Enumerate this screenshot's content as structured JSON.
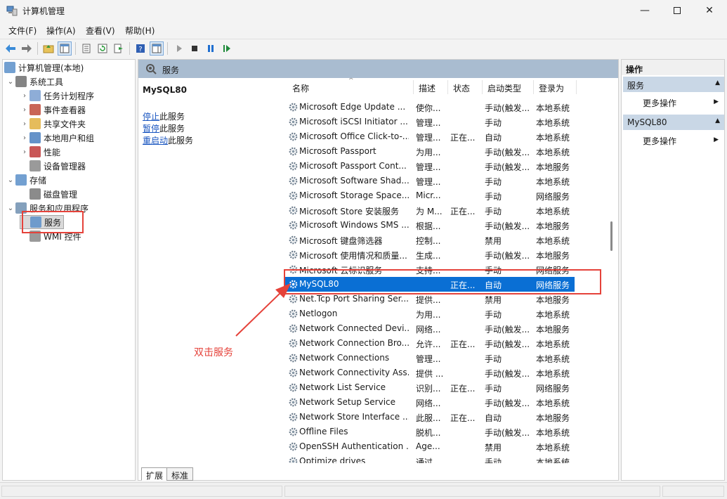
{
  "window": {
    "title": "计算机管理",
    "minimize_icon": "minimize-icon",
    "maximize_icon": "maximize-icon",
    "close_icon": "close-icon"
  },
  "menu": [
    "文件(F)",
    "操作(A)",
    "查看(V)",
    "帮助(H)"
  ],
  "toolbar": {
    "icons": [
      "back-arrow-icon",
      "forward-arrow-icon",
      "up-folder-icon",
      "show-hide-tree-icon",
      "properties-icon",
      "refresh-icon",
      "export-list-icon",
      "help-icon",
      "show-hide-action-pane-icon",
      "start-service-icon",
      "stop-service-icon",
      "pause-service-icon",
      "resume-service-icon"
    ]
  },
  "tree": [
    {
      "label": "计算机管理(本地)",
      "level": 0,
      "chevron": "",
      "icon": "computer-management-icon"
    },
    {
      "label": "系统工具",
      "level": 1,
      "chevron": "⌄",
      "icon": "tools-icon"
    },
    {
      "label": "任务计划程序",
      "level": 2,
      "chevron": "›",
      "icon": "task-scheduler-icon"
    },
    {
      "label": "事件查看器",
      "level": 2,
      "chevron": "›",
      "icon": "event-viewer-icon"
    },
    {
      "label": "共享文件夹",
      "level": 2,
      "chevron": "›",
      "icon": "shared-folder-icon"
    },
    {
      "label": "本地用户和组",
      "level": 2,
      "chevron": "›",
      "icon": "users-groups-icon"
    },
    {
      "label": "性能",
      "level": 2,
      "chevron": "›",
      "icon": "performance-icon"
    },
    {
      "label": "设备管理器",
      "level": 2,
      "chevron": "",
      "icon": "device-manager-icon"
    },
    {
      "label": "存储",
      "level": 1,
      "chevron": "⌄",
      "icon": "storage-icon"
    },
    {
      "label": "磁盘管理",
      "level": 2,
      "chevron": "",
      "icon": "disk-management-icon"
    },
    {
      "label": "服务和应用程序",
      "level": 1,
      "chevron": "⌄",
      "icon": "services-apps-icon"
    },
    {
      "label": "服务",
      "level": 2,
      "chevron": "",
      "icon": "services-icon",
      "selected": true
    },
    {
      "label": "WMI 控件",
      "level": 2,
      "chevron": "",
      "icon": "wmi-control-icon"
    }
  ],
  "center": {
    "header": "服务",
    "selected_service": "MySQL80",
    "actions": [
      {
        "link": "停止",
        "rest": "此服务"
      },
      {
        "link": "暂停",
        "rest": "此服务"
      },
      {
        "link": "重启动",
        "rest": "此服务"
      }
    ],
    "columns": [
      "名称",
      "描述",
      "状态",
      "启动类型",
      "登录为"
    ],
    "rows": [
      {
        "name": "Microsoft Edge Update ...",
        "desc": "使你...",
        "status": "",
        "startup": "手动(触发...",
        "logon": "本地系统"
      },
      {
        "name": "Microsoft iSCSI Initiator ...",
        "desc": "管理...",
        "status": "",
        "startup": "手动",
        "logon": "本地系统"
      },
      {
        "name": "Microsoft Office Click-to-...",
        "desc": "管理...",
        "status": "正在...",
        "startup": "自动",
        "logon": "本地系统"
      },
      {
        "name": "Microsoft Passport",
        "desc": "为用...",
        "status": "",
        "startup": "手动(触发...",
        "logon": "本地系统"
      },
      {
        "name": "Microsoft Passport Cont...",
        "desc": "管理...",
        "status": "",
        "startup": "手动(触发...",
        "logon": "本地服务"
      },
      {
        "name": "Microsoft Software Shad...",
        "desc": "管理...",
        "status": "",
        "startup": "手动",
        "logon": "本地系统"
      },
      {
        "name": "Microsoft Storage Space...",
        "desc": "Micr...",
        "status": "",
        "startup": "手动",
        "logon": "网络服务"
      },
      {
        "name": "Microsoft Store 安装服务",
        "desc": "为 M...",
        "status": "正在...",
        "startup": "手动",
        "logon": "本地系统"
      },
      {
        "name": "Microsoft Windows SMS ...",
        "desc": "根据...",
        "status": "",
        "startup": "手动(触发...",
        "logon": "本地服务"
      },
      {
        "name": "Microsoft 键盘筛选器",
        "desc": "控制...",
        "status": "",
        "startup": "禁用",
        "logon": "本地系统"
      },
      {
        "name": "Microsoft 使用情况和质量...",
        "desc": "生成...",
        "status": "",
        "startup": "手动(触发...",
        "logon": "本地服务"
      },
      {
        "name": "Microsoft 云标识服务",
        "desc": "支持...",
        "status": "",
        "startup": "手动",
        "logon": "网络服务"
      },
      {
        "name": "MySQL80",
        "desc": "",
        "status": "正在...",
        "startup": "自动",
        "logon": "网络服务",
        "selected": true
      },
      {
        "name": "Net.Tcp Port Sharing Ser...",
        "desc": "提供...",
        "status": "",
        "startup": "禁用",
        "logon": "本地服务"
      },
      {
        "name": "Netlogon",
        "desc": "为用...",
        "status": "",
        "startup": "手动",
        "logon": "本地系统"
      },
      {
        "name": "Network Connected Devi...",
        "desc": "网络...",
        "status": "",
        "startup": "手动(触发...",
        "logon": "本地服务"
      },
      {
        "name": "Network Connection Bro...",
        "desc": "允许...",
        "status": "正在...",
        "startup": "手动(触发...",
        "logon": "本地系统"
      },
      {
        "name": "Network Connections",
        "desc": "管理...",
        "status": "",
        "startup": "手动",
        "logon": "本地系统"
      },
      {
        "name": "Network Connectivity Ass...",
        "desc": "提供 ...",
        "status": "",
        "startup": "手动(触发...",
        "logon": "本地系统"
      },
      {
        "name": "Network List Service",
        "desc": "识别...",
        "status": "正在...",
        "startup": "手动",
        "logon": "网络服务"
      },
      {
        "name": "Network Setup Service",
        "desc": "网络...",
        "status": "",
        "startup": "手动(触发...",
        "logon": "本地系统"
      },
      {
        "name": "Network Store Interface ...",
        "desc": "此服...",
        "status": "正在...",
        "startup": "自动",
        "logon": "本地服务"
      },
      {
        "name": "Offline Files",
        "desc": "脱机...",
        "status": "",
        "startup": "手动(触发...",
        "logon": "本地系统"
      },
      {
        "name": "OpenSSH Authentication ...",
        "desc": "Age...",
        "status": "",
        "startup": "禁用",
        "logon": "本地系统"
      },
      {
        "name": "Optimize drives",
        "desc": "通过...",
        "status": "",
        "startup": "手动",
        "logon": "本地系统"
      }
    ],
    "tabs": [
      "扩展",
      "标准"
    ]
  },
  "actions_panel": {
    "title": "操作",
    "groups": [
      {
        "label": "服务",
        "item": "更多操作"
      },
      {
        "label": "MySQL80",
        "item": "更多操作"
      }
    ]
  },
  "annotation": {
    "text": "双击服务",
    "color": "#e5423a"
  },
  "colors": {
    "selection": "#0a6fd4",
    "header_bar": "#a9bcd0",
    "action_group": "#c9d7e6",
    "link": "#1a56c0"
  }
}
